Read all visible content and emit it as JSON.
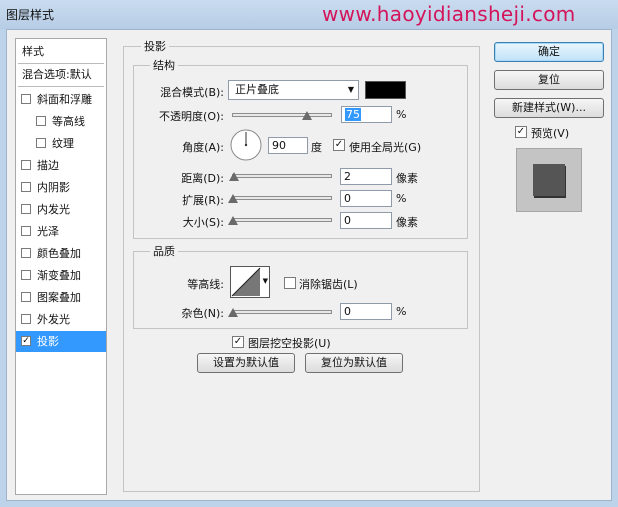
{
  "window": {
    "title": "图层样式",
    "watermark": "www.haoyidiansheji.com"
  },
  "style_list": {
    "header": "样式",
    "blend_options": "混合选项:默认",
    "items": [
      {
        "label": "斜面和浮雕",
        "checked": false
      },
      {
        "label": "等高线",
        "checked": false,
        "indent": true
      },
      {
        "label": "纹理",
        "checked": false,
        "indent": true
      },
      {
        "label": "描边",
        "checked": false
      },
      {
        "label": "内阴影",
        "checked": false
      },
      {
        "label": "内发光",
        "checked": false
      },
      {
        "label": "光泽",
        "checked": false
      },
      {
        "label": "颜色叠加",
        "checked": false
      },
      {
        "label": "渐变叠加",
        "checked": false
      },
      {
        "label": "图案叠加",
        "checked": false
      },
      {
        "label": "外发光",
        "checked": false
      },
      {
        "label": "投影",
        "checked": true,
        "selected": true
      }
    ]
  },
  "panel": {
    "title": "投影",
    "structure": {
      "title": "结构",
      "blend_mode_label": "混合模式(B):",
      "blend_mode_value": "正片叠底",
      "shadow_color": "#000000",
      "opacity_label": "不透明度(O):",
      "opacity_value": "75",
      "opacity_unit": "%",
      "opacity_level": 0.75,
      "angle_label": "角度(A):",
      "angle_value": "90",
      "angle_unit": "度",
      "global_light_label": "使用全局光(G)",
      "global_light_checked": true,
      "distance_label": "距离(D):",
      "distance_value": "2",
      "distance_unit": "像素",
      "spread_label": "扩展(R):",
      "spread_value": "0",
      "spread_unit": "%",
      "size_label": "大小(S):",
      "size_value": "0",
      "size_unit": "像素"
    },
    "quality": {
      "title": "品质",
      "contour_label": "等高线:",
      "anti_alias_label": "消除锯齿(L)",
      "anti_alias_checked": false,
      "noise_label": "杂色(N):",
      "noise_value": "0",
      "noise_unit": "%"
    },
    "knockout_label": "图层挖空投影(U)",
    "knockout_checked": true,
    "make_default_label": "设置为默认值",
    "reset_default_label": "复位为默认值"
  },
  "buttons": {
    "ok": "确定",
    "reset": "复位",
    "new_style": "新建样式(W)...",
    "preview_label": "预览(V)",
    "preview_checked": true
  },
  "checkmark": "✓",
  "colors": {
    "selection": "#3399ff",
    "watermark": "#d4145a"
  }
}
